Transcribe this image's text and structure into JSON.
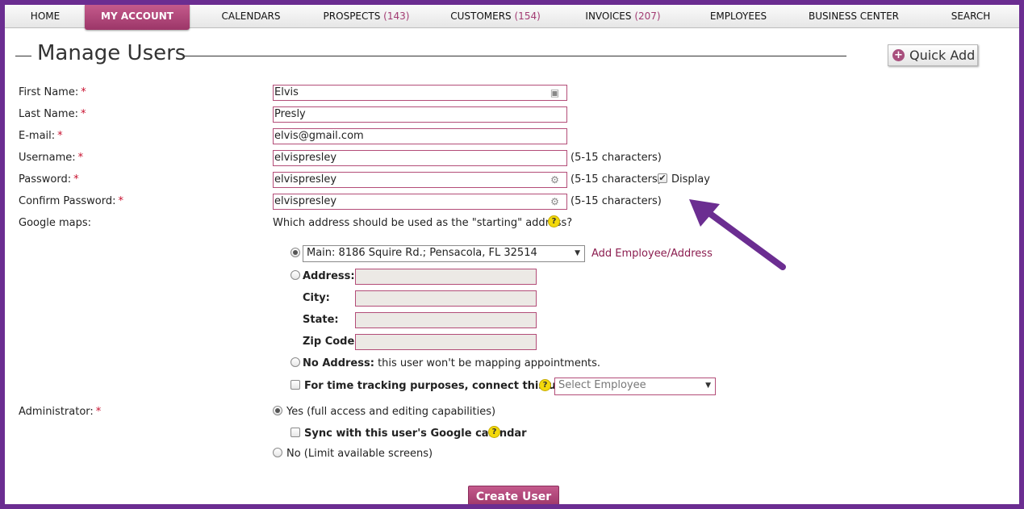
{
  "nav": {
    "items": [
      {
        "label": "HOME",
        "count": ""
      },
      {
        "label": "MY ACCOUNT",
        "count": ""
      },
      {
        "label": "CALENDARS",
        "count": ""
      },
      {
        "label": "PROSPECTS",
        "count": "(143)"
      },
      {
        "label": "CUSTOMERS",
        "count": "(154)"
      },
      {
        "label": "INVOICES",
        "count": "(207)"
      },
      {
        "label": "EMPLOYEES",
        "count": ""
      },
      {
        "label": "BUSINESS CENTER",
        "count": ""
      },
      {
        "label": "SEARCH",
        "count": ""
      }
    ],
    "active": "MY ACCOUNT"
  },
  "header": {
    "title": "Manage Users",
    "quick_add": "Quick Add"
  },
  "form": {
    "first_name": {
      "label": "First Name:",
      "value": "Elvis"
    },
    "last_name": {
      "label": "Last Name:",
      "value": "Presly"
    },
    "email": {
      "label": "E-mail:",
      "value": "elvis@gmail.com"
    },
    "username": {
      "label": "Username:",
      "value": "elvispresley",
      "hint": "(5-15 characters)"
    },
    "password": {
      "label": "Password:",
      "value": "elvispresley",
      "hint": "(5-15 characters)",
      "display_label": "Display",
      "display_checked": true
    },
    "confirm_password": {
      "label": "Confirm Password:",
      "value": "elvispresley",
      "hint": "(5-15 characters)"
    },
    "required_mark": "*",
    "google_maps": {
      "label": "Google maps:",
      "question": "Which address should be used as the \"starting\" address?",
      "main_option": "Main: 8186 Squire Rd.; Pensacola, FL 32514",
      "add_link": "Add Employee/Address",
      "address_label": "Address:",
      "city_label": "City:",
      "state_label": "State:",
      "zip_label": "Zip Code:",
      "no_address_bold": "No Address:",
      "no_address_text": "this user won't be mapping appointments.",
      "time_tracking_label": "For time tracking purposes, connect this user to:",
      "employee_placeholder": "Select Employee"
    },
    "administrator": {
      "label": "Administrator:",
      "yes_label": "Yes (full access and editing capabilities)",
      "sync_label": "Sync with this user's Google calendar",
      "no_label": "No (Limit available screens)"
    },
    "create_button": "Create User"
  },
  "colors": {
    "brand": "#9c3668",
    "frame": "#6b2d91",
    "arrow": "#6b2d91",
    "help": "#f3d90b"
  },
  "icons": {
    "help": "?",
    "check": "✔",
    "dropdown": "▼"
  }
}
